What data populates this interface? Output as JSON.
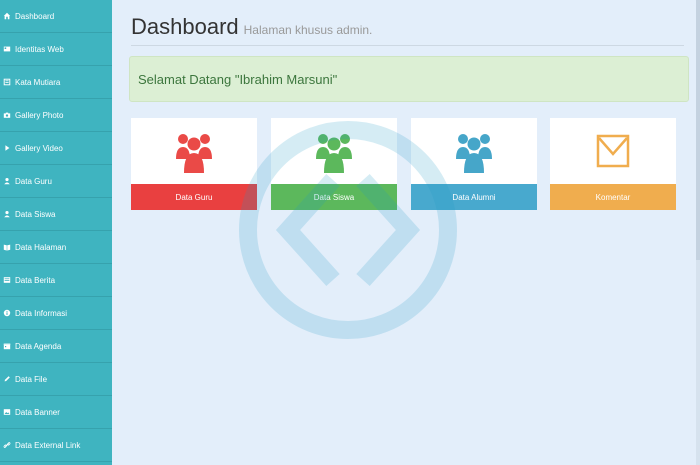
{
  "sidebar": {
    "items": [
      {
        "label": "Dashboard",
        "icon": "dashboard-icon"
      },
      {
        "label": "Identitas Web",
        "icon": "card-icon"
      },
      {
        "label": "Kata Mutiara",
        "icon": "quote-icon"
      },
      {
        "label": "Gallery Photo",
        "icon": "camera-icon"
      },
      {
        "label": "Gallery Video",
        "icon": "play-icon"
      },
      {
        "label": "Data Guru",
        "icon": "user-icon"
      },
      {
        "label": "Data Siswa",
        "icon": "user-icon"
      },
      {
        "label": "Data Halaman",
        "icon": "book-icon"
      },
      {
        "label": "Data Berita",
        "icon": "newspaper-icon"
      },
      {
        "label": "Data Informasi",
        "icon": "info-icon"
      },
      {
        "label": "Data Agenda",
        "icon": "calendar-icon"
      },
      {
        "label": "Data File",
        "icon": "pencil-icon"
      },
      {
        "label": "Data Banner",
        "icon": "image-icon"
      },
      {
        "label": "Data External Link",
        "icon": "link-icon"
      }
    ]
  },
  "header": {
    "title": "Dashboard",
    "subtitle": "Halaman khusus admin."
  },
  "welcome": {
    "text": "Selamat Datang \"Ibrahim Marsuni\""
  },
  "cards": [
    {
      "label": "Data Guru",
      "icon": "users-icon",
      "color": "#f04c4c",
      "bg": "#e94040"
    },
    {
      "label": "Data Siswa",
      "icon": "users-icon",
      "color": "#5cb85c",
      "bg": "#5cb85c"
    },
    {
      "label": "Data Alumni",
      "icon": "users-icon",
      "color": "#46a6c9",
      "bg": "#48a9ce"
    },
    {
      "label": "Komentar",
      "icon": "envelope-icon",
      "color": "#f0ad4e",
      "bg": "#f0ad4e"
    }
  ]
}
